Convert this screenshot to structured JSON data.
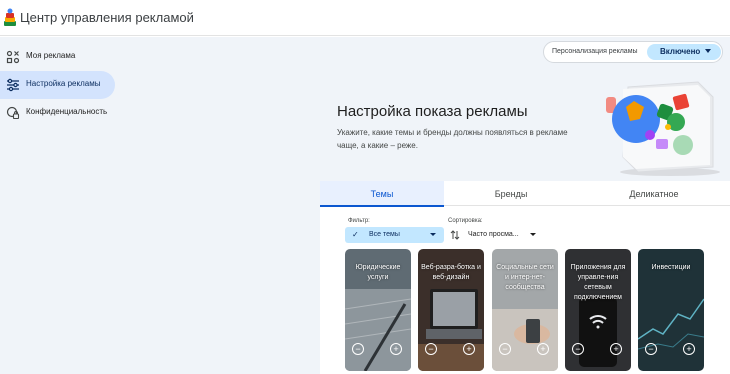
{
  "app": {
    "title": "Центр управления рекламой"
  },
  "sidebar": {
    "items": [
      {
        "label": "Моя реклама",
        "icon": "my-ads-icon",
        "active": false
      },
      {
        "label": "Настройка рекламы",
        "icon": "ad-settings-icon",
        "active": true
      },
      {
        "label": "Конфиденциальность",
        "icon": "privacy-icon",
        "active": false
      }
    ]
  },
  "personalization": {
    "label": "Персонализация рекламы",
    "value": "Включено"
  },
  "hero": {
    "title": "Настройка показа рекламы",
    "subtitle": "Укажите, какие темы и бренды должны появляться в рекламе чаще, а какие – реже."
  },
  "tabs": [
    {
      "label": "Темы",
      "active": true
    },
    {
      "label": "Бренды",
      "active": false
    },
    {
      "label": "Деликатное",
      "active": false
    }
  ],
  "filter": {
    "label": "Фильтр:",
    "value": "Все темы"
  },
  "sort": {
    "label": "Сортировка:",
    "value": "Часто просма..."
  },
  "cards": [
    {
      "title": "Юридические услуги"
    },
    {
      "title": "Веб-разра-ботка и веб-дизайн"
    },
    {
      "title": "Социальные сети и интер-нет-сообщества"
    },
    {
      "title": "Приложения для управле-ния сетевым подключением"
    },
    {
      "title": "Инвестиции"
    }
  ],
  "colors": {
    "accent": "#0b57d0",
    "chip": "#c2e7ff",
    "sidebar_bg": "#f0f4f9",
    "active_nav": "#d3e3fd"
  }
}
